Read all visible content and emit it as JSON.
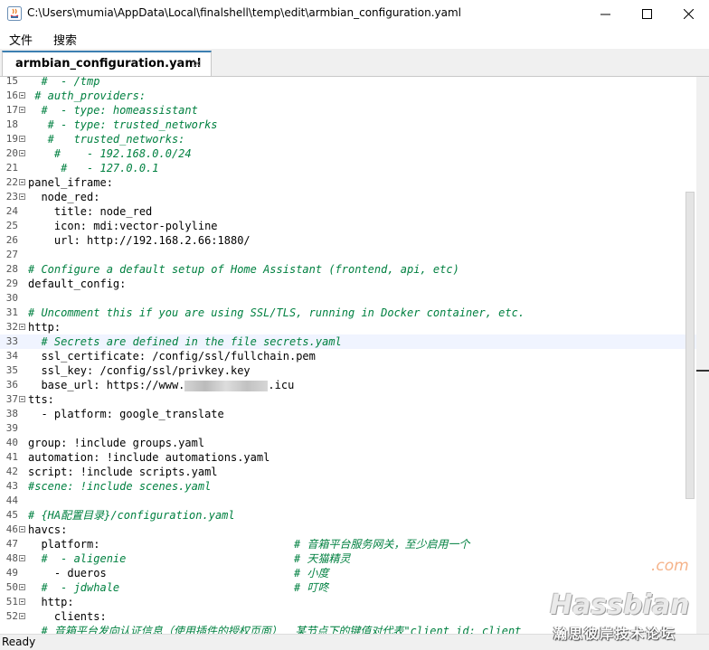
{
  "window": {
    "title": "C:\\Users\\mumia\\AppData\\Local\\finalshell\\temp\\edit\\armbian_configuration.yaml"
  },
  "menu": [
    "文件",
    "搜索"
  ],
  "tab": {
    "label": "armbian_configuration.yaml",
    "close": "×"
  },
  "current_line": 33,
  "lines": [
    {
      "n": "15",
      "t": "  #  - /tmp",
      "c": true
    },
    {
      "n": "16",
      "t": " # auth_providers:",
      "c": true,
      "f": true
    },
    {
      "n": "17",
      "t": "  #  - type: homeassistant",
      "c": true,
      "f": true
    },
    {
      "n": "18",
      "t": "   # - type: trusted_networks",
      "c": true
    },
    {
      "n": "19",
      "t": "   #   trusted_networks:",
      "c": true,
      "f": true
    },
    {
      "n": "20",
      "t": "    #    - 192.168.0.0/24",
      "c": true,
      "f": true
    },
    {
      "n": "21",
      "t": "     #   - 127.0.0.1",
      "c": true
    },
    {
      "n": "22",
      "t": "panel_iframe:",
      "f": true
    },
    {
      "n": "23",
      "t": "  node_red:",
      "f": true
    },
    {
      "n": "24",
      "t": "    title: node_red"
    },
    {
      "n": "25",
      "t": "    icon: mdi:vector-polyline"
    },
    {
      "n": "26",
      "t": "    url: http://192.168.2.66:1880/"
    },
    {
      "n": "27",
      "t": ""
    },
    {
      "n": "28",
      "t": "# Configure a default setup of Home Assistant (frontend, api, etc)",
      "c": true
    },
    {
      "n": "29",
      "t": "default_config:"
    },
    {
      "n": "30",
      "t": ""
    },
    {
      "n": "31",
      "t": "# Uncomment this if you are using SSL/TLS, running in Docker container, etc.",
      "c": true
    },
    {
      "n": "32",
      "t": "http:",
      "f": true
    },
    {
      "n": "33",
      "t": "  # Secrets are defined in the file secrets.yaml",
      "c": true
    },
    {
      "n": "34",
      "t": "  ssl_certificate: /config/ssl/fullchain.pem"
    },
    {
      "n": "35",
      "t": "  ssl_key: /config/ssl/privkey.key"
    },
    {
      "n": "36",
      "t": "  base_url: https://www.",
      "blur_after": ".icu"
    },
    {
      "n": "37",
      "t": "tts:",
      "f": true
    },
    {
      "n": "38",
      "t": "  - platform: google_translate"
    },
    {
      "n": "39",
      "t": ""
    },
    {
      "n": "40",
      "t": "group: !include groups.yaml"
    },
    {
      "n": "41",
      "t": "automation: !include automations.yaml"
    },
    {
      "n": "42",
      "t": "script: !include scripts.yaml"
    },
    {
      "n": "43",
      "t": "#scene: !include scenes.yaml",
      "c": true
    },
    {
      "n": "44",
      "t": ""
    },
    {
      "n": "45",
      "t": "# {HA配置目录}/configuration.yaml",
      "c": true
    },
    {
      "n": "46",
      "t": "havcs:",
      "f": true
    },
    {
      "n": "47",
      "t": "  platform:",
      "comment": "# 音箱平台服务网关，至少启用一个"
    },
    {
      "n": "48",
      "t": "  #  - aligenie",
      "c": true,
      "f": true,
      "comment": "# 天猫精灵"
    },
    {
      "n": "49",
      "t": "    - dueros",
      "comment": "# 小度"
    },
    {
      "n": "50",
      "t": "  #  - jdwhale",
      "c": true,
      "f": true,
      "comment": "# 叮咚"
    },
    {
      "n": "51",
      "t": "  http:",
      "f": true
    },
    {
      "n": "52",
      "t": "    clients:",
      "f": true
    },
    {
      "n": "",
      "t": "  # 音箱平台发向认证信息（使用插件的授权页面）  某节点下的键值对代表\"client_id: client_",
      "c": true
    }
  ],
  "status": {
    "text": "Ready"
  },
  "watermark": {
    "com": ".com",
    "logo": "Hassbian",
    "forum": "瀚思彼岸技术论坛"
  }
}
